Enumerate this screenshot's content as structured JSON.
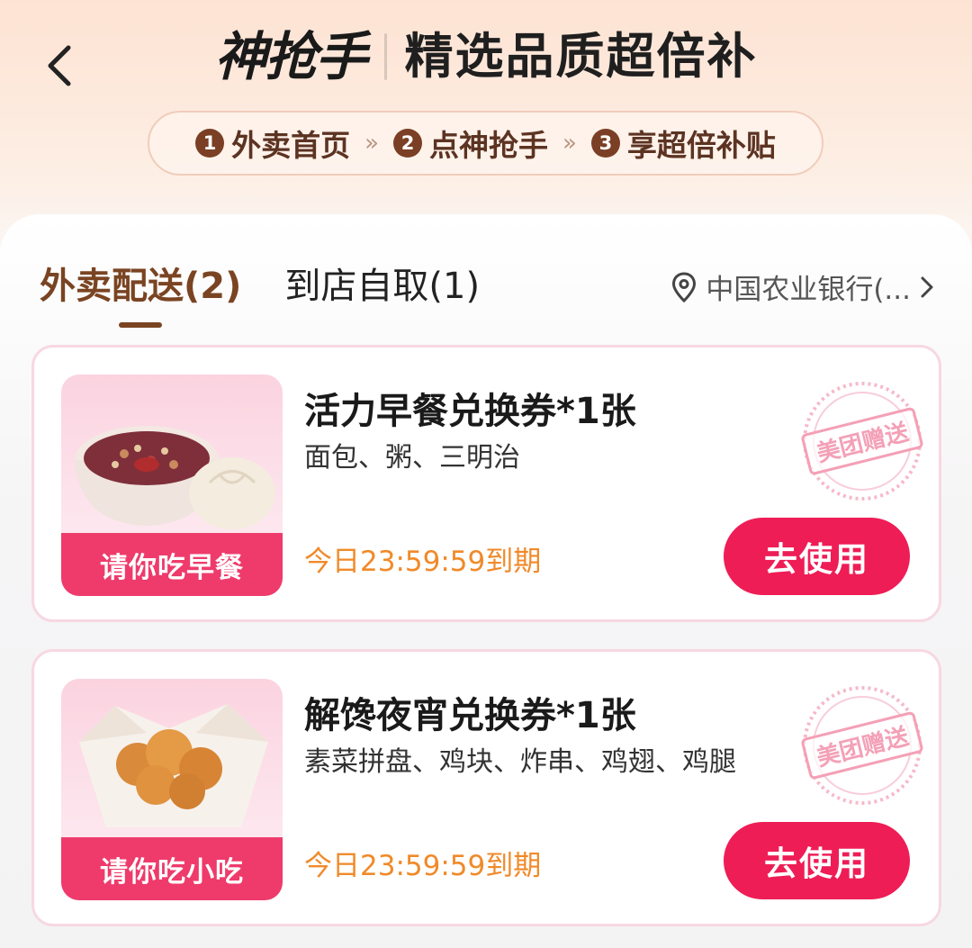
{
  "header": {
    "brand": "神抢手",
    "title": "精选品质超倍补",
    "steps": [
      {
        "num": "1",
        "label": "外卖首页"
      },
      {
        "num": "2",
        "label": "点神抢手"
      },
      {
        "num": "3",
        "label": "享超倍补贴"
      }
    ],
    "step_separator": "»"
  },
  "tabs": [
    {
      "label": "外卖配送(2)",
      "active": true
    },
    {
      "label": "到店自取(1)",
      "active": false
    }
  ],
  "location": {
    "text": "中国农业银行(...",
    "icon": "location-pin-icon"
  },
  "vouchers": [
    {
      "banner": "请你吃早餐",
      "title": "活力早餐兑换券*1张",
      "desc": "面包、粥、三明治",
      "expiry": "今日23:59:59到期",
      "button": "去使用",
      "stamp": "美团赠送"
    },
    {
      "banner": "请你吃小吃",
      "title": "解馋夜宵兑换券*1张",
      "desc": "素菜拼盘、鸡块、炸串、鸡翅、鸡腿",
      "expiry": "今日23:59:59到期",
      "button": "去使用",
      "stamp": "美团赠送"
    }
  ],
  "colors": {
    "accent": "#ee1d56",
    "brown": "#7a4422",
    "expiry": "#f08a2a"
  }
}
